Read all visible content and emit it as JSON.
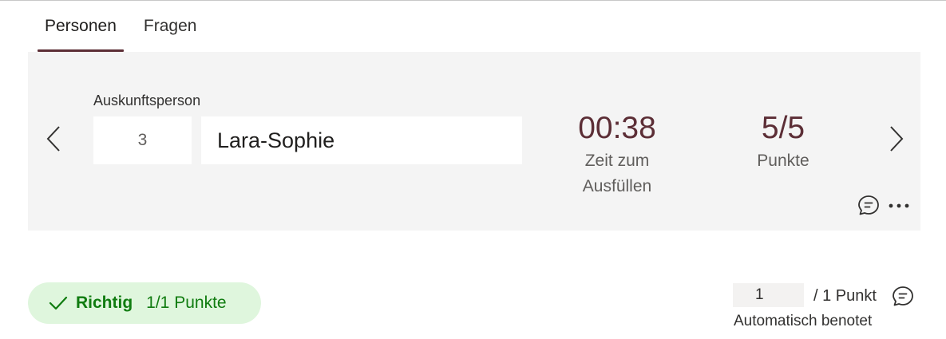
{
  "tabs": [
    {
      "label": "Personen",
      "active": true
    },
    {
      "label": "Fragen",
      "active": false
    }
  ],
  "respondent": {
    "label": "Auskunftsperson",
    "number": "3",
    "name": "Lara-Sophie"
  },
  "stats": {
    "time_value": "00:38",
    "time_label_line1": "Zeit zum",
    "time_label_line2": "Ausfüllen",
    "score_value": "5/5",
    "score_label": "Punkte"
  },
  "icons": {
    "prev": "chevron-left-icon",
    "next": "chevron-right-icon",
    "comment": "comment-icon",
    "more": "more-horizontal-icon",
    "check": "checkmark-icon"
  },
  "result": {
    "verdict": "Richtig",
    "points": "1/1 Punkte"
  },
  "grading": {
    "value": "1",
    "total": "/ 1 Punkt",
    "note": "Automatisch benotet"
  },
  "colors": {
    "accent": "#5c2e36",
    "panel_bg": "#f4f4f4",
    "success_bg": "#dff6dd",
    "success_text": "#107c10"
  }
}
